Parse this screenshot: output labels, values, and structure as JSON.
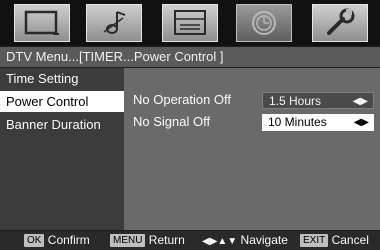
{
  "header": {
    "tabs": [
      {
        "icon": "tv-screen-icon"
      },
      {
        "icon": "music-note-icon"
      },
      {
        "icon": "setup-panel-icon"
      },
      {
        "icon": "clock-icon",
        "active": true
      },
      {
        "icon": "wrench-icon"
      }
    ]
  },
  "title": "DTV Menu...[TIMER...Power Control ]",
  "left_menu": {
    "items": [
      {
        "label": "Time Setting"
      },
      {
        "label": "Power Control",
        "selected": true
      },
      {
        "label": "Banner Duration"
      }
    ]
  },
  "options": [
    {
      "label": "No Operation Off",
      "value": "1.5 Hours",
      "arrows": "◀▶"
    },
    {
      "label": "No Signal Off",
      "value": "10 Minutes",
      "arrows": "◀▶"
    }
  ],
  "help": {
    "ok_key": "OK",
    "ok_label": "Confirm",
    "menu_key": "MENU",
    "menu_label": "Return",
    "nav_label": "Navigate",
    "exit_key": "EXIT",
    "exit_label": "Cancel"
  }
}
